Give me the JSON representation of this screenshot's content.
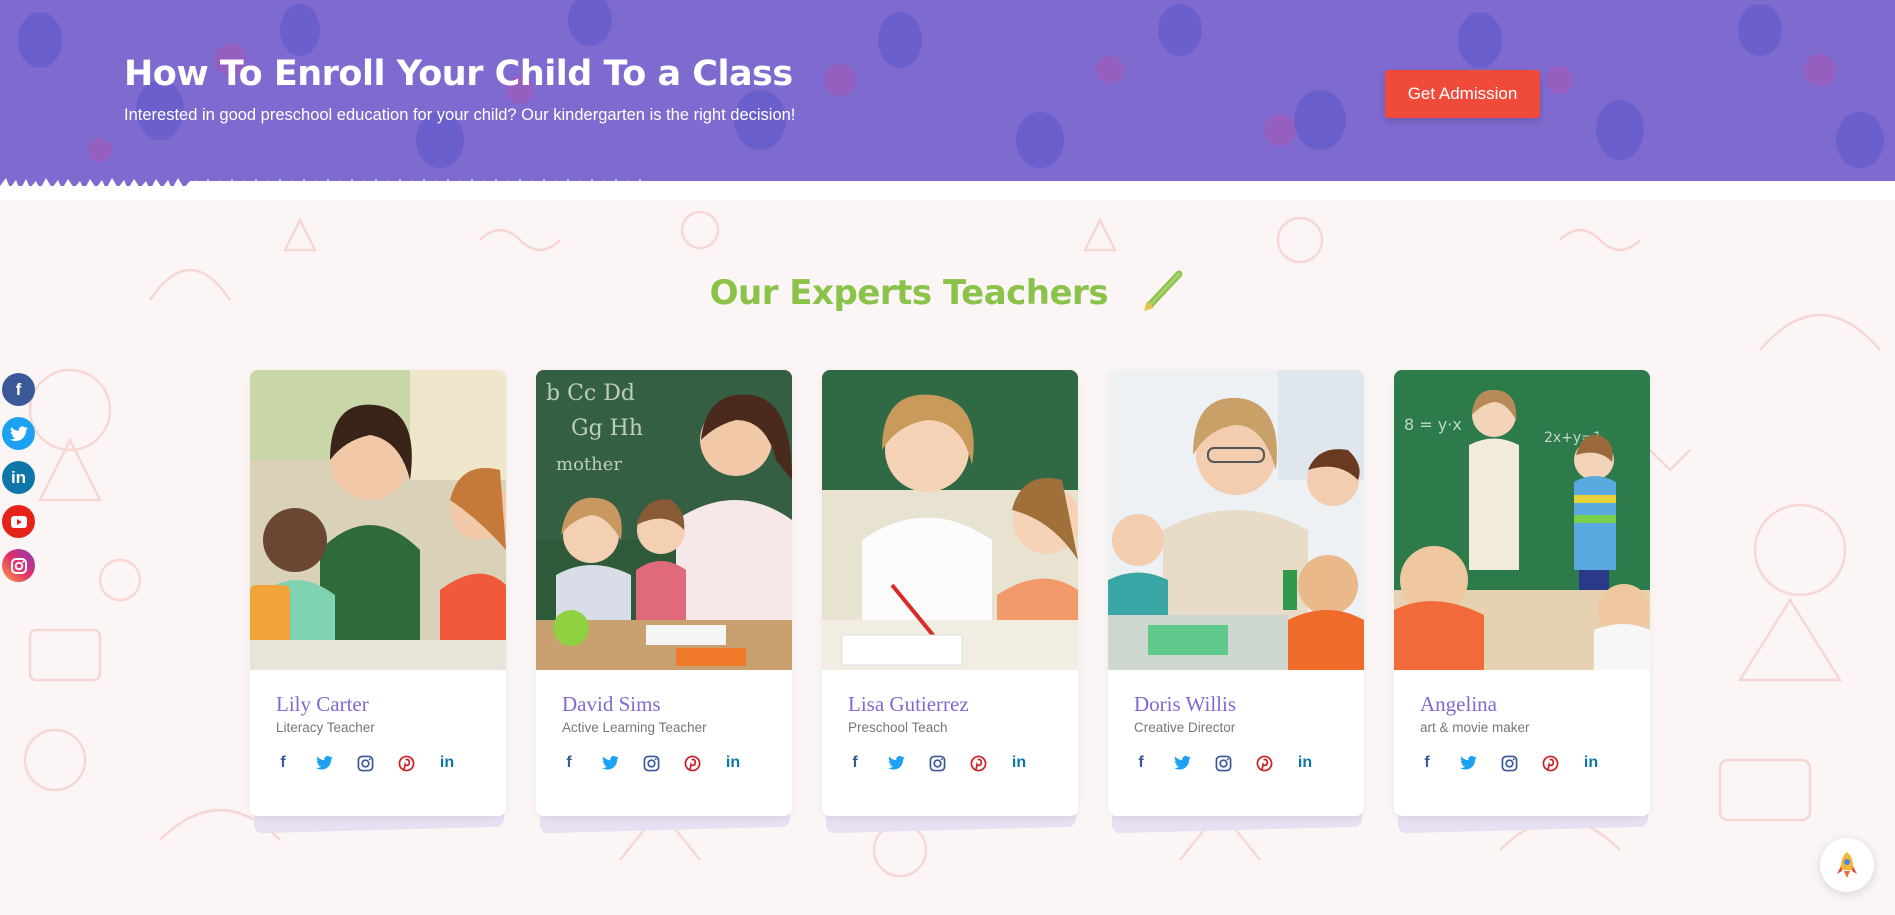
{
  "banner": {
    "title": "How To Enroll Your Child To a Class",
    "subtitle": "Interested in good preschool education for your child? Our kindergarten is the right decision!",
    "button_label": "Get Admission",
    "bg_color": "#7f6bd0",
    "button_color": "#f04a3a"
  },
  "section": {
    "title": "Our Experts Teachers",
    "title_color": "#8bc34a",
    "title_icon": "pencil-icon"
  },
  "social_sidebar": {
    "icons": [
      "facebook-icon",
      "twitter-icon",
      "linkedin-icon",
      "youtube-icon",
      "instagram-icon"
    ]
  },
  "teachers": [
    {
      "name": "Lily Carter",
      "role": "Literacy Teacher"
    },
    {
      "name": "David Sims",
      "role": "Active Learning Teacher"
    },
    {
      "name": "Lisa Gutierrez",
      "role": "Preschool Teach"
    },
    {
      "name": "Doris Willis",
      "role": "Creative Director"
    },
    {
      "name": "Angelina",
      "role": "art & movie maker"
    }
  ],
  "card_social_icons": [
    "facebook-icon",
    "twitter-icon",
    "instagram-icon",
    "pinterest-icon",
    "linkedin-icon"
  ],
  "back_to_top": {
    "icon": "rocket-icon"
  },
  "colors": {
    "accent": "#7f6bd0",
    "green": "#8bc34a",
    "red": "#f04a3a"
  }
}
